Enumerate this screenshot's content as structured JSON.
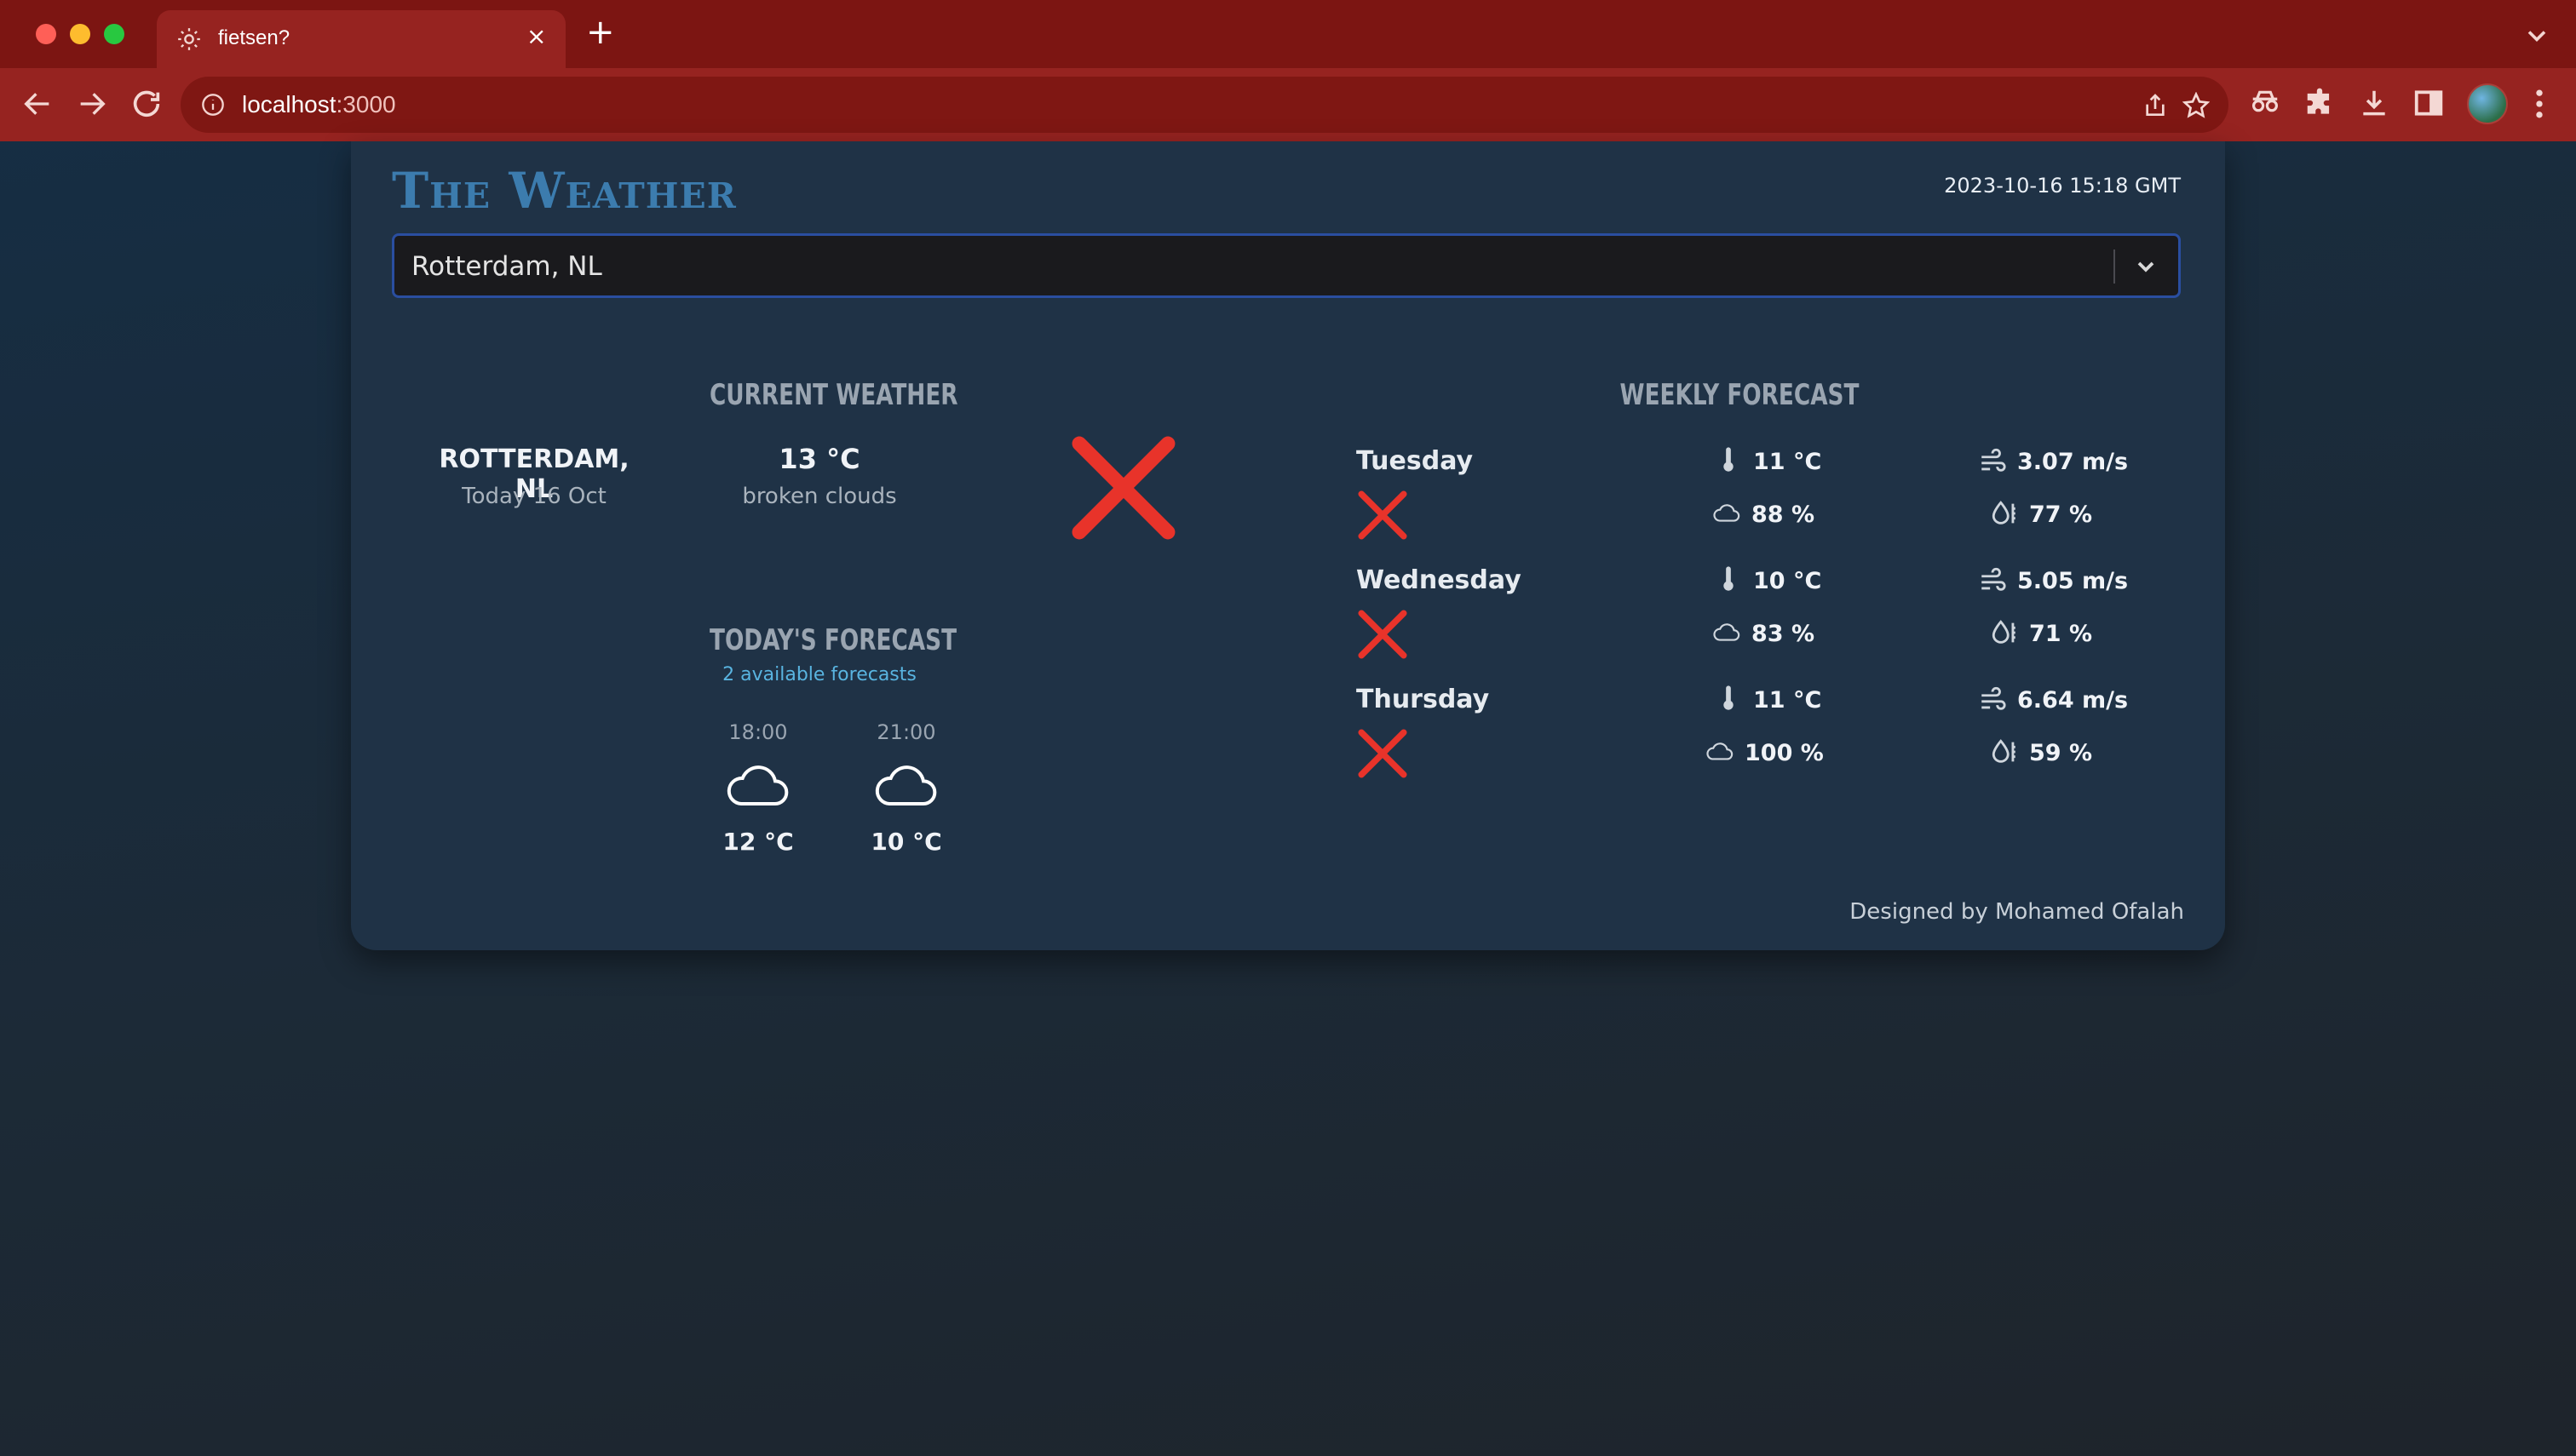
{
  "browser": {
    "tab_title": "fietsen?",
    "tab_close": "×",
    "new_tab": "+",
    "url_host": "localhost",
    "url_port": ":3000"
  },
  "app": {
    "title": "The Weather",
    "timestamp": "2023-10-16 15:18 GMT",
    "location_select": {
      "value": "Rotterdam, NL"
    },
    "footer": "Designed by Mohamed Ofalah"
  },
  "current": {
    "heading": "CURRENT WEATHER",
    "city": "ROTTERDAM, NL",
    "date": "Today 16 Oct",
    "temperature": "13 °C",
    "description": "broken clouds",
    "icon": "broken-image-x"
  },
  "today": {
    "heading": "TODAY'S FORECAST",
    "count_label": "2 available forecasts",
    "items": [
      {
        "time": "18:00",
        "icon": "cloud-icon",
        "temp": "12 °C"
      },
      {
        "time": "21:00",
        "icon": "cloud-icon",
        "temp": "10 °C"
      }
    ]
  },
  "weekly": {
    "heading": "WEEKLY FORECAST",
    "days": [
      {
        "day": "Tuesday",
        "temp": "11 °C",
        "wind": "3.07 m/s",
        "clouds": "88 %",
        "humidity": "77 %"
      },
      {
        "day": "Wednesday",
        "temp": "10 °C",
        "wind": "5.05 m/s",
        "clouds": "83 %",
        "humidity": "71 %"
      },
      {
        "day": "Thursday",
        "temp": "11 °C",
        "wind": "6.64 m/s",
        "clouds": "100 %",
        "humidity": "59 %"
      }
    ]
  },
  "colors": {
    "browser_frame": "#7c1512",
    "card_bg": "#1f3246",
    "title_blue": "#3c7cae",
    "accent_cyan": "#59b4e0",
    "broken_icon_red": "#e8332a"
  }
}
